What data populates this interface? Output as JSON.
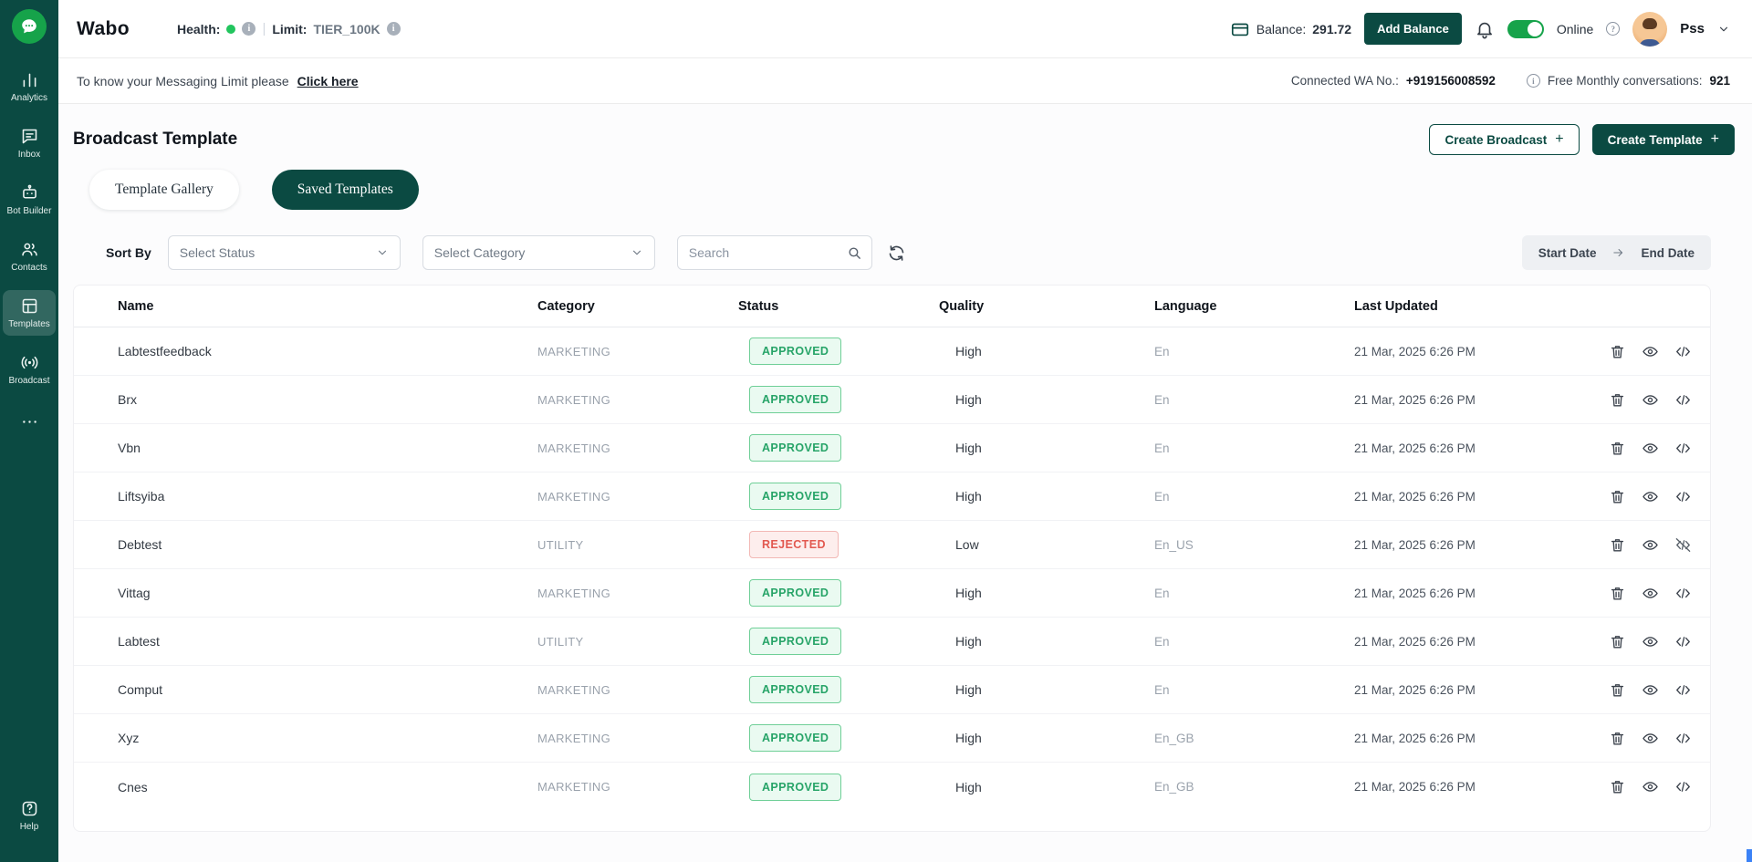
{
  "colors": {
    "brand": "#0b4a42",
    "accent": "#16a34a",
    "approved_text": "#27a468",
    "approved_bg": "#eafaf1",
    "approved_border": "#6fcf97",
    "rejected_text": "#e25950",
    "rejected_bg": "#fdeeed",
    "rejected_border": "#f2b8b5"
  },
  "sidebar": {
    "items": [
      {
        "label": "Analytics"
      },
      {
        "label": "Inbox"
      },
      {
        "label": "Bot Builder"
      },
      {
        "label": "Contacts"
      },
      {
        "label": "Templates"
      },
      {
        "label": "Broadcast"
      }
    ],
    "help_label": "Help"
  },
  "header": {
    "brand": "Wabo",
    "health_label": "Health:",
    "separator": "|",
    "limit_label": "Limit:",
    "limit_value": "TIER_100K",
    "balance_label": "Balance:",
    "balance_value": "291.72",
    "add_balance": "Add Balance",
    "online_label": "Online",
    "user": "Pss"
  },
  "infobar": {
    "notice": "To know your Messaging Limit please",
    "link": "Click here",
    "wa_label": "Connected WA No.:",
    "wa_number": "+919156008592",
    "conversations_label": "Free Monthly conversations:",
    "conversations_value": "921"
  },
  "page": {
    "title": "Broadcast Template",
    "create_broadcast": "Create Broadcast",
    "create_template": "Create Template",
    "plus": "+",
    "tab_gallery": "Template Gallery",
    "tab_saved": "Saved Templates",
    "sort_by": "Sort By",
    "select_status": "Select Status",
    "select_category": "Select Category",
    "search_placeholder": "Search",
    "start_date": "Start Date",
    "end_date": "End Date"
  },
  "table": {
    "columns": [
      "Name",
      "Category",
      "Status",
      "Quality",
      "Language",
      "Last Updated"
    ],
    "rows": [
      {
        "name": "Labtestfeedback",
        "category": "MARKETING",
        "status": "APPROVED",
        "quality": "High",
        "language": "En",
        "updated": "21 Mar, 2025 6:26 PM"
      },
      {
        "name": "Brx",
        "category": "MARKETING",
        "status": "APPROVED",
        "quality": "High",
        "language": "En",
        "updated": "21 Mar, 2025 6:26 PM"
      },
      {
        "name": "Vbn",
        "category": "MARKETING",
        "status": "APPROVED",
        "quality": "High",
        "language": "En",
        "updated": "21 Mar, 2025 6:26 PM"
      },
      {
        "name": "Liftsyiba",
        "category": "MARKETING",
        "status": "APPROVED",
        "quality": "High",
        "language": "En",
        "updated": "21 Mar, 2025 6:26 PM"
      },
      {
        "name": "Debtest",
        "category": "UTILITY",
        "status": "REJECTED",
        "quality": "Low",
        "language": "En_US",
        "updated": "21 Mar, 2025 6:26 PM"
      },
      {
        "name": "Vittag",
        "category": "MARKETING",
        "status": "APPROVED",
        "quality": "High",
        "language": "En",
        "updated": "21 Mar, 2025 6:26 PM"
      },
      {
        "name": "Labtest",
        "category": "UTILITY",
        "status": "APPROVED",
        "quality": "High",
        "language": "En",
        "updated": "21 Mar, 2025 6:26 PM"
      },
      {
        "name": "Comput",
        "category": "MARKETING",
        "status": "APPROVED",
        "quality": "High",
        "language": "En",
        "updated": "21 Mar, 2025 6:26 PM"
      },
      {
        "name": "Xyz",
        "category": "MARKETING",
        "status": "APPROVED",
        "quality": "High",
        "language": "En_GB",
        "updated": "21 Mar, 2025 6:26 PM"
      },
      {
        "name": "Cnes",
        "category": "MARKETING",
        "status": "APPROVED",
        "quality": "High",
        "language": "En_GB",
        "updated": "21 Mar, 2025 6:26 PM"
      }
    ]
  }
}
